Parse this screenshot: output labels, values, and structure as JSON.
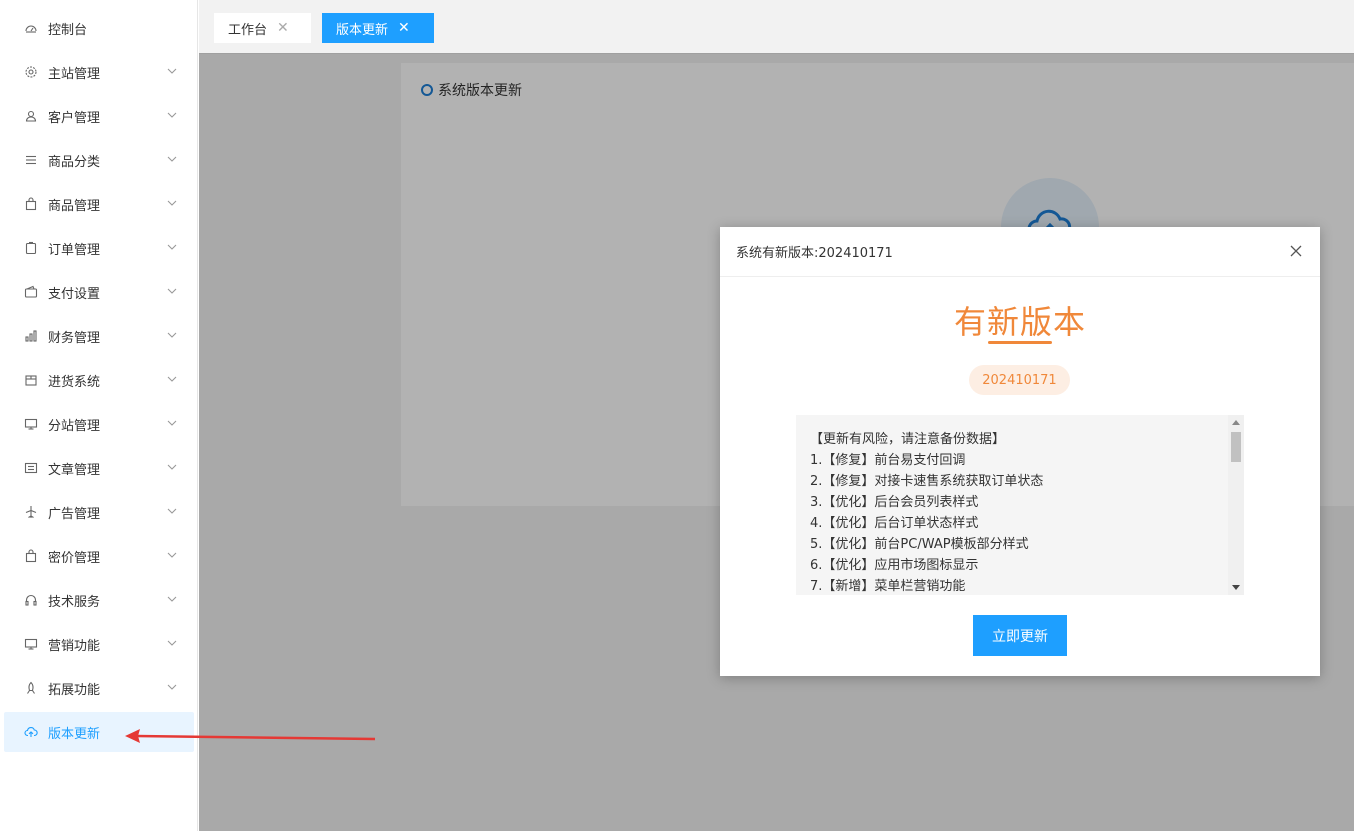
{
  "sidebar": {
    "items": [
      {
        "label": "控制台",
        "icon": "dashboard-icon",
        "has_chevron": false
      },
      {
        "label": "主站管理",
        "icon": "gear-icon",
        "has_chevron": true
      },
      {
        "label": "客户管理",
        "icon": "user-icon",
        "has_chevron": true
      },
      {
        "label": "商品分类",
        "icon": "list-icon",
        "has_chevron": true
      },
      {
        "label": "商品管理",
        "icon": "bag-icon",
        "has_chevron": true
      },
      {
        "label": "订单管理",
        "icon": "clipboard-icon",
        "has_chevron": true
      },
      {
        "label": "支付设置",
        "icon": "wallet-icon",
        "has_chevron": true
      },
      {
        "label": "财务管理",
        "icon": "bar-chart-icon",
        "has_chevron": true
      },
      {
        "label": "进货系统",
        "icon": "box-icon",
        "has_chevron": true
      },
      {
        "label": "分站管理",
        "icon": "monitor-icon",
        "has_chevron": true
      },
      {
        "label": "文章管理",
        "icon": "document-icon",
        "has_chevron": true
      },
      {
        "label": "广告管理",
        "icon": "airplane-icon",
        "has_chevron": true
      },
      {
        "label": "密价管理",
        "icon": "bag-icon",
        "has_chevron": true
      },
      {
        "label": "技术服务",
        "icon": "headset-icon",
        "has_chevron": true
      },
      {
        "label": "营销功能",
        "icon": "monitor-icon",
        "has_chevron": true
      },
      {
        "label": "拓展功能",
        "icon": "rocket-icon",
        "has_chevron": true
      },
      {
        "label": "版本更新",
        "icon": "cloud-upload-icon",
        "has_chevron": false,
        "active": true
      }
    ]
  },
  "tabs": [
    {
      "label": "工作台",
      "close": "✕"
    },
    {
      "label": "版本更新",
      "close": "✕",
      "active": true
    }
  ],
  "card": {
    "title": "系统版本更新"
  },
  "dialog": {
    "header": "系统有新版本:202410171",
    "title": "有新版本",
    "version": "202410171",
    "notes": [
      "【更新有风险，请注意备份数据】",
      "1.【修复】前台易支付回调",
      "2.【修复】对接卡速售系统获取订单状态",
      "3.【优化】后台会员列表样式",
      "4.【优化】后台订单状态样式",
      "5.【优化】前台PC/WAP模板部分样式",
      "6.【优化】应用市场图标显示",
      "7.【新增】菜单栏营销功能"
    ],
    "button": "立即更新"
  },
  "colors": {
    "accent": "#1e9fff",
    "orange": "#f0883a",
    "arrow": "#e53935"
  }
}
